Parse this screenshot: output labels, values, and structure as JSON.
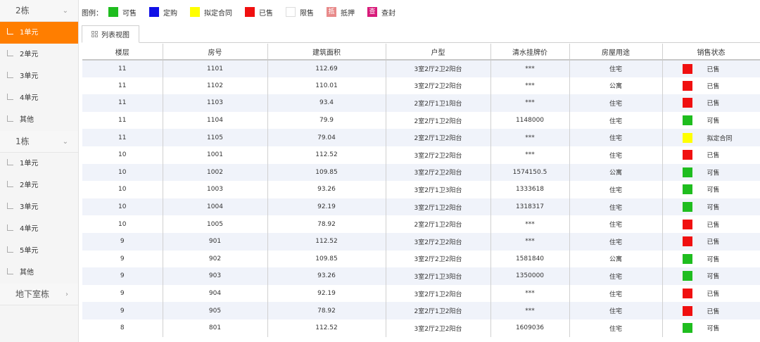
{
  "sidebar": {
    "groups": [
      {
        "label": "2栋",
        "units": [
          "1单元",
          "2单元",
          "3单元",
          "4单元",
          "其他"
        ],
        "active_index": 0
      },
      {
        "label": "1栋",
        "units": [
          "1单元",
          "2单元",
          "3单元",
          "4单元",
          "5单元",
          "其他"
        ],
        "active_index": -1
      },
      {
        "label": "地下室栋",
        "units": [],
        "active_index": -1
      }
    ]
  },
  "legend": {
    "title": "图例：",
    "items": [
      {
        "label": "可售",
        "color": "#1fbd1f",
        "glyph": ""
      },
      {
        "label": "定购",
        "color": "#1010e6",
        "glyph": ""
      },
      {
        "label": "拟定合同",
        "color": "#ffff00",
        "glyph": ""
      },
      {
        "label": "已售",
        "color": "#f01010",
        "glyph": ""
      },
      {
        "label": "限售",
        "color": "#ffffff",
        "glyph": ""
      },
      {
        "label": "抵押",
        "color": "#e88a8a",
        "glyph": "抵"
      },
      {
        "label": "查封",
        "color": "#d81b7a",
        "glyph": "查"
      }
    ]
  },
  "tab": {
    "label": "列表视图"
  },
  "table": {
    "columns": [
      "楼层",
      "房号",
      "建筑面积",
      "户型",
      "清水挂牌价",
      "房屋用途",
      "销售状态"
    ],
    "rows": [
      [
        "11",
        "1101",
        "112.69",
        "3室2厅2卫2阳台",
        "***",
        "住宅",
        "已售"
      ],
      [
        "11",
        "1102",
        "110.01",
        "3室2厅2卫2阳台",
        "***",
        "公寓",
        "已售"
      ],
      [
        "11",
        "1103",
        "93.4",
        "2室2厅1卫1阳台",
        "***",
        "住宅",
        "已售"
      ],
      [
        "11",
        "1104",
        "79.9",
        "2室2厅1卫2阳台",
        "1148000",
        "住宅",
        "可售"
      ],
      [
        "11",
        "1105",
        "79.04",
        "2室2厅1卫2阳台",
        "***",
        "住宅",
        "拟定合同"
      ],
      [
        "10",
        "1001",
        "112.52",
        "3室2厅2卫2阳台",
        "***",
        "住宅",
        "已售"
      ],
      [
        "10",
        "1002",
        "109.85",
        "3室2厅2卫2阳台",
        "1574150.5",
        "公寓",
        "可售"
      ],
      [
        "10",
        "1003",
        "93.26",
        "3室2厅1卫3阳台",
        "1333618",
        "住宅",
        "可售"
      ],
      [
        "10",
        "1004",
        "92.19",
        "3室2厅1卫2阳台",
        "1318317",
        "住宅",
        "可售"
      ],
      [
        "10",
        "1005",
        "78.92",
        "2室2厅1卫2阳台",
        "***",
        "住宅",
        "已售"
      ],
      [
        "9",
        "901",
        "112.52",
        "3室2厅2卫2阳台",
        "***",
        "住宅",
        "已售"
      ],
      [
        "9",
        "902",
        "109.85",
        "3室2厅2卫2阳台",
        "1581840",
        "公寓",
        "可售"
      ],
      [
        "9",
        "903",
        "93.26",
        "3室2厅1卫3阳台",
        "1350000",
        "住宅",
        "可售"
      ],
      [
        "9",
        "904",
        "92.19",
        "3室2厅1卫2阳台",
        "***",
        "住宅",
        "已售"
      ],
      [
        "9",
        "905",
        "78.92",
        "2室2厅1卫2阳台",
        "***",
        "住宅",
        "已售"
      ],
      [
        "8",
        "801",
        "112.52",
        "3室2厅2卫2阳台",
        "1609036",
        "住宅",
        "可售"
      ]
    ]
  }
}
